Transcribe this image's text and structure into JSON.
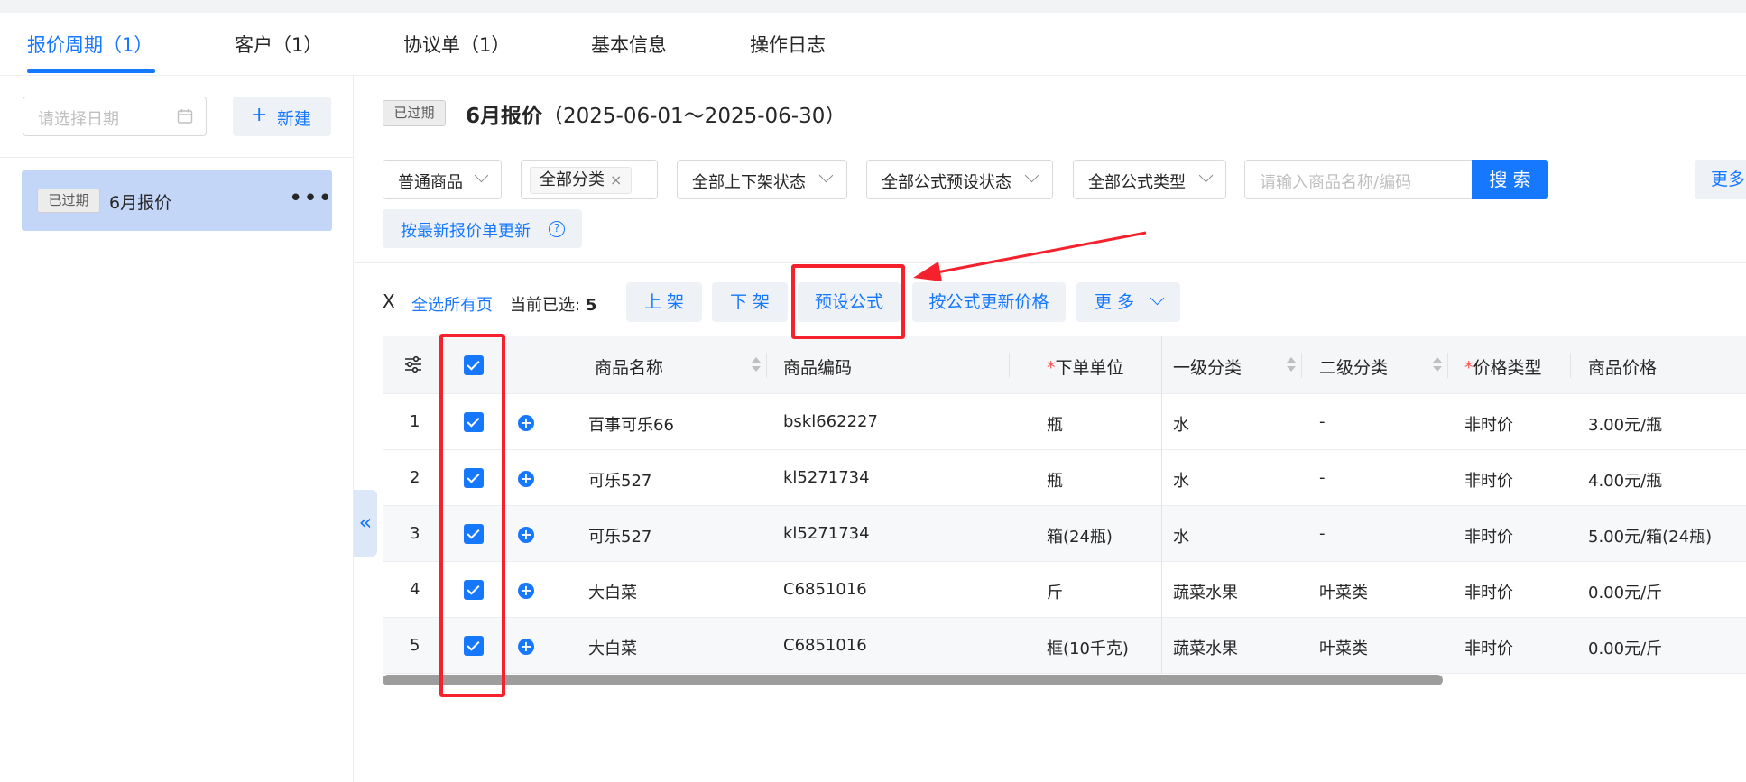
{
  "tabs": [
    {
      "label": "报价周期（1）",
      "active": true
    },
    {
      "label": "客户（1）",
      "active": false
    },
    {
      "label": "协议单（1）",
      "active": false
    },
    {
      "label": "基本信息",
      "active": false
    },
    {
      "label": "操作日志",
      "active": false
    }
  ],
  "left": {
    "date_placeholder": "请选择日期",
    "new_label": "新建",
    "periods": [
      {
        "badge": "已过期",
        "name": "6月报价",
        "more": "•••"
      }
    ]
  },
  "header": {
    "badge": "已过期",
    "title": "6月报价",
    "range": "（2025-06-01～2025-06-30）"
  },
  "filters": {
    "goods_type": "普通商品",
    "category_tag": "全部分类",
    "shelf_status": "全部上下架状态",
    "preset_status": "全部公式预设状态",
    "formula_type": "全部公式类型",
    "search_placeholder": "请输入商品名称/编码",
    "search_label": "搜 索",
    "more_label": "更多",
    "update_label": "按最新报价单更新"
  },
  "actions": {
    "close": "X",
    "select_all_pages": "全选所有页",
    "selected_prefix": "当前已选:",
    "selected_count": "5",
    "on_shelf": "上 架",
    "off_shelf": "下 架",
    "preset_formula": "预设公式",
    "update_by_formula": "按公式更新价格",
    "more": "更 多"
  },
  "table": {
    "headers": {
      "name": "商品名称",
      "code": "商品编码",
      "unit": "下单单位",
      "cat1": "一级分类",
      "cat2": "二级分类",
      "price_type": "价格类型",
      "price": "商品价格"
    },
    "required_mark": "*",
    "rows": [
      {
        "no": "1",
        "name": "百事可乐66",
        "code": "bskl662227",
        "unit": "瓶",
        "cat1": "水",
        "cat2": "-",
        "price_type": "非时价",
        "price": "3.00元/瓶"
      },
      {
        "no": "2",
        "name": "可乐527",
        "code": "kl5271734",
        "unit": "瓶",
        "cat1": "水",
        "cat2": "-",
        "price_type": "非时价",
        "price": "4.00元/瓶"
      },
      {
        "no": "3",
        "name": "可乐527",
        "code": "kl5271734",
        "unit": "箱(24瓶)",
        "cat1": "水",
        "cat2": "-",
        "price_type": "非时价",
        "price": "5.00元/箱(24瓶)"
      },
      {
        "no": "4",
        "name": "大白菜",
        "code": "C6851016",
        "unit": "斤",
        "cat1": "蔬菜水果",
        "cat2": "叶菜类",
        "price_type": "非时价",
        "price": "0.00元/斤"
      },
      {
        "no": "5",
        "name": "大白菜",
        "code": "C6851016",
        "unit": "框(10千克)",
        "cat1": "蔬菜水果",
        "cat2": "叶菜类",
        "price_type": "非时价",
        "price": "0.00元/斤"
      }
    ]
  },
  "colors": {
    "accent": "#1677ff",
    "annotation": "#f5222d"
  },
  "icons": [
    "calendar-icon",
    "plus-icon",
    "more-icon",
    "chevron-down-icon",
    "close-icon",
    "help-icon",
    "settings-icon",
    "add-circle-icon",
    "collapse-left-icon"
  ]
}
